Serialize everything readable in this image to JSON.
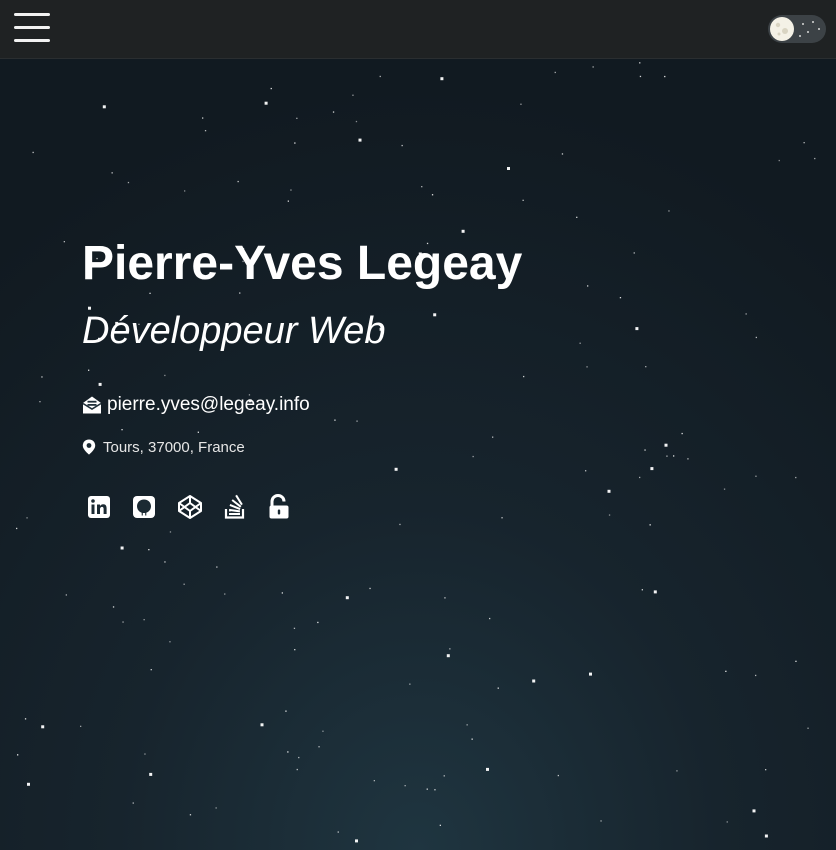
{
  "header": {
    "menu_icon": "hamburger-menu-icon",
    "theme_toggle": {
      "state": "dark",
      "knob_icon": "moon-icon"
    }
  },
  "profile": {
    "name": "Pierre-Yves Legeay",
    "job_title": "Développeur Web",
    "email": "pierre.yves@legeay.info",
    "email_icon": "envelope-open-icon",
    "location": "Tours, 37000, France",
    "location_icon": "map-marker-icon"
  },
  "social_links": [
    {
      "icon": "linkedin-icon"
    },
    {
      "icon": "github-icon"
    },
    {
      "icon": "codepen-icon"
    },
    {
      "icon": "stackoverflow-icon"
    },
    {
      "icon": "unlock-icon"
    }
  ],
  "colors": {
    "background": "#17242d",
    "topbar": "#1f2223",
    "text": "#ffffff"
  }
}
